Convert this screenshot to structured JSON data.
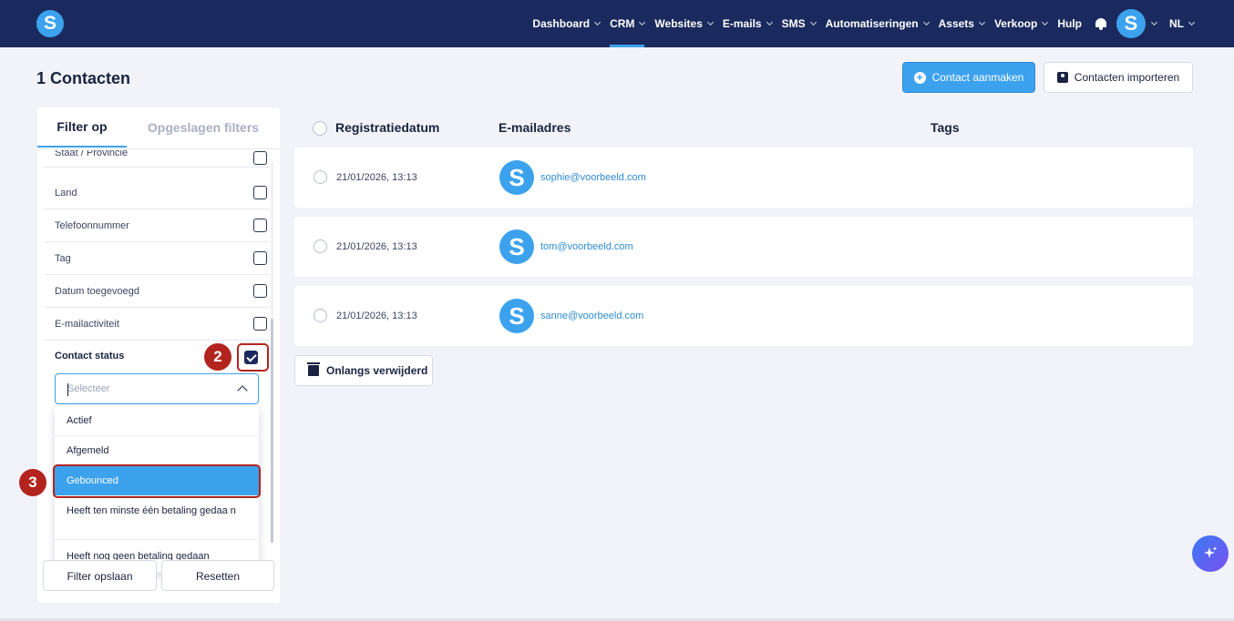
{
  "app": {
    "logo_letter": "S"
  },
  "nav": {
    "items": [
      {
        "label": "Dashboard",
        "chevron": true
      },
      {
        "label": "CRM",
        "chevron": true,
        "active": true
      },
      {
        "label": "Websites",
        "chevron": true
      },
      {
        "label": "E-mails",
        "chevron": true
      },
      {
        "label": "SMS",
        "chevron": true
      },
      {
        "label": "Automatiseringen",
        "chevron": true
      },
      {
        "label": "Assets",
        "chevron": true
      },
      {
        "label": "Verkoop",
        "chevron": true
      },
      {
        "label": "Hulp",
        "chevron": false
      }
    ],
    "avatar_letter": "S",
    "language": "NL"
  },
  "header": {
    "title": "1 Contacten",
    "create_button": "Contact aanmaken",
    "import_button": "Contacten importeren"
  },
  "filter_panel": {
    "tabs": [
      "Filter op",
      "Opgeslagen filters"
    ],
    "partial_row_label": "Staat / Provincie",
    "rows": [
      "Land",
      "Telefoonnummer",
      "Tag",
      "Datum toegevoegd",
      "E-mailactiviteit"
    ],
    "contact_status": {
      "label": "Contact status",
      "checked": true,
      "select_placeholder": "Selecteer",
      "options": [
        "Actief",
        "Afgemeld",
        "Gebounced",
        "Heeft ten minste één betaling gedaa n",
        "Heeft nog geen betaling gedaan"
      ],
      "highlighted_option": "Gebounced"
    },
    "save_button": "Filter opslaan",
    "reset_button": "Resetten"
  },
  "annotations": {
    "step_2": "2",
    "step_3": "3"
  },
  "table": {
    "headers": [
      "Registratiedatum",
      "E-mailadres",
      "Tags"
    ],
    "rows": [
      {
        "date": "21/01/2026, 13:13",
        "avatar": "S",
        "email": "sophie@voorbeeld.com",
        "tags": ""
      },
      {
        "date": "21/01/2026, 13:13",
        "avatar": "S",
        "email": "tom@voorbeeld.com",
        "tags": ""
      },
      {
        "date": "21/01/2026, 13:13",
        "avatar": "S",
        "email": "sanne@voorbeeld.com",
        "tags": ""
      }
    ]
  },
  "deleted_button": "Onlangs verwijderd",
  "colors": {
    "nav_bg": "#1b2a5e",
    "accent": "#3ca2ee",
    "annotation_red": "#b3241e",
    "page_bg": "#f1f3f8"
  },
  "icons": [
    "bell-icon",
    "plus-circle-icon",
    "contact-card-icon",
    "trash-icon",
    "sparkle-icon"
  ]
}
